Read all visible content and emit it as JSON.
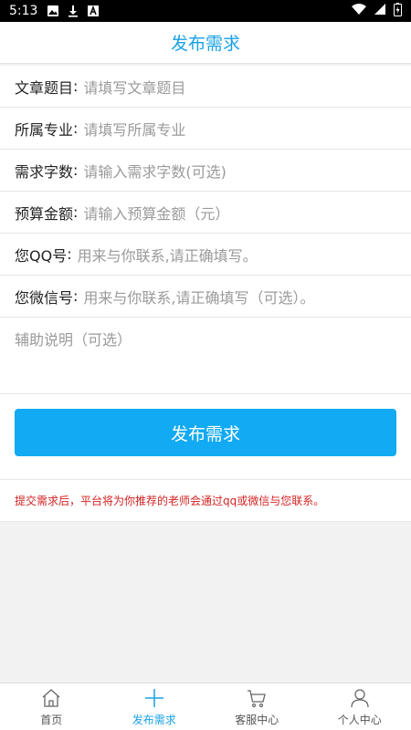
{
  "status_bar": {
    "time": "5:13",
    "icons": [
      "image-icon",
      "download-icon",
      "a-icon",
      "wifi-icon",
      "signal-icon",
      "battery-icon"
    ]
  },
  "header": {
    "title": "发布需求"
  },
  "form": {
    "fields": [
      {
        "label": "文章题目",
        "placeholder": "请填写文章题目"
      },
      {
        "label": "所属专业",
        "placeholder": "请填写所属专业"
      },
      {
        "label": "需求字数",
        "placeholder": "请输入需求字数(可选)"
      },
      {
        "label": "预算金额",
        "placeholder": "请输入预算金额（元）"
      },
      {
        "label": "您QQ号",
        "placeholder": "用来与你联系,请正确填写。"
      },
      {
        "label": "您微信号",
        "placeholder": "用来与你联系,请正确填写（可选）。"
      }
    ],
    "note_placeholder": "辅助说明（可选）",
    "submit_label": "发布需求",
    "notice": "提交需求后，平台将为你推荐的老师会通过qq或微信与您联系。"
  },
  "bottom_nav": {
    "items": [
      {
        "label": "首页",
        "icon": "home-icon"
      },
      {
        "label": "发布需求",
        "icon": "plus-icon"
      },
      {
        "label": "客服中心",
        "icon": "cart-icon"
      },
      {
        "label": "个人中心",
        "icon": "person-icon"
      }
    ],
    "active_index": 1
  },
  "colors": {
    "accent": "#1aa1e6",
    "button": "#12aaf2",
    "notice": "#d42222"
  }
}
